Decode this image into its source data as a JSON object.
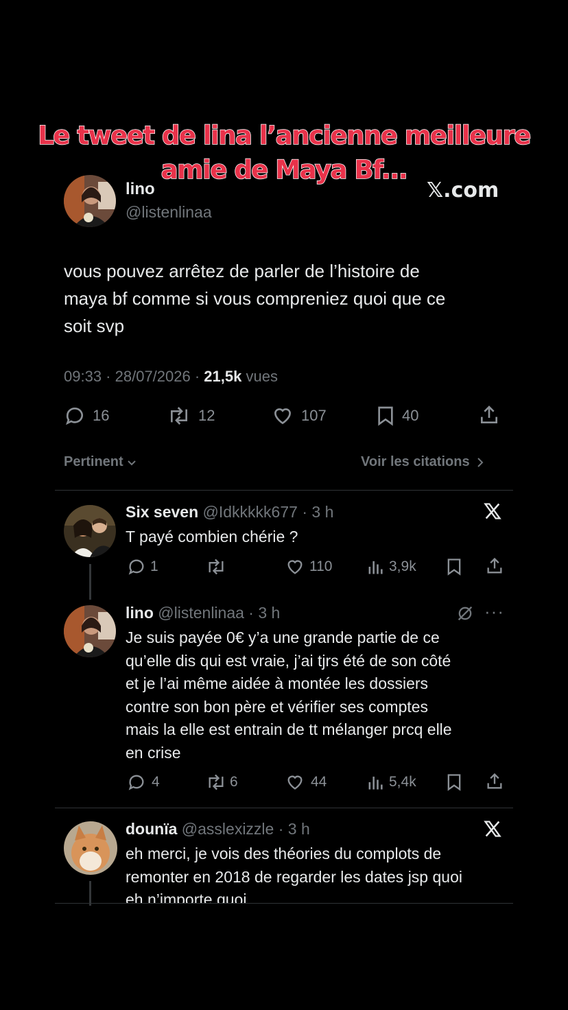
{
  "overlay": {
    "line1": "Le tweet de lina l’ancienne meilleure",
    "line2": "amie de Maya Bf...",
    "watermark": "𝕏.com"
  },
  "tweet": {
    "author_name": "lino",
    "author_handle": "@listenlinaa",
    "text_line1": "vous pouvez arrêtez de parler de l’histoire de",
    "text_line2": "maya bf comme si vous compreniez quoi que ce",
    "text_line3": "soit svp",
    "time": "09:33",
    "date": "28/07/2026",
    "views_count": "21,5k",
    "views_label": "vues",
    "replies": "16",
    "reposts": "12",
    "likes": "107",
    "bookmarks": "40"
  },
  "sort": {
    "label": "Pertinent",
    "quotes_link": "Voir les citations"
  },
  "replies": [
    {
      "name": "Six seven",
      "handle": "@Idkkkkk677",
      "time": "3 h",
      "lines": [
        "T payé combien chérie ?"
      ],
      "replies": "1",
      "reposts": "",
      "likes": "110",
      "views": "3,9k"
    },
    {
      "name": "lino",
      "handle": "@listenlinaa",
      "time": "3 h",
      "lines": [
        "Je suis payée 0€ y’a une grande partie de ce",
        "qu’elle dis qui est vraie, j’ai tjrs été de son côté",
        "et je l’ai même aidée à montée les dossiers",
        "contre son bon père et vérifier ses comptes",
        "mais la elle est entrain de tt mélanger prcq elle",
        "en crise"
      ],
      "replies": "4",
      "reposts": "6",
      "likes": "44",
      "views": "5,4k"
    },
    {
      "name": "dounïa",
      "handle": "@asslexizzle",
      "time": "3 h",
      "lines": [
        "eh merci, je vois des théories du complots de",
        "remonter en 2018 de regarder les dates jsp quoi",
        "eh n’importe quoi"
      ]
    }
  ],
  "colors": {
    "background": "#000000",
    "text": "#e7e9ea",
    "muted": "#71767b",
    "caption": "#e8324a",
    "divider": "#2f3336"
  }
}
